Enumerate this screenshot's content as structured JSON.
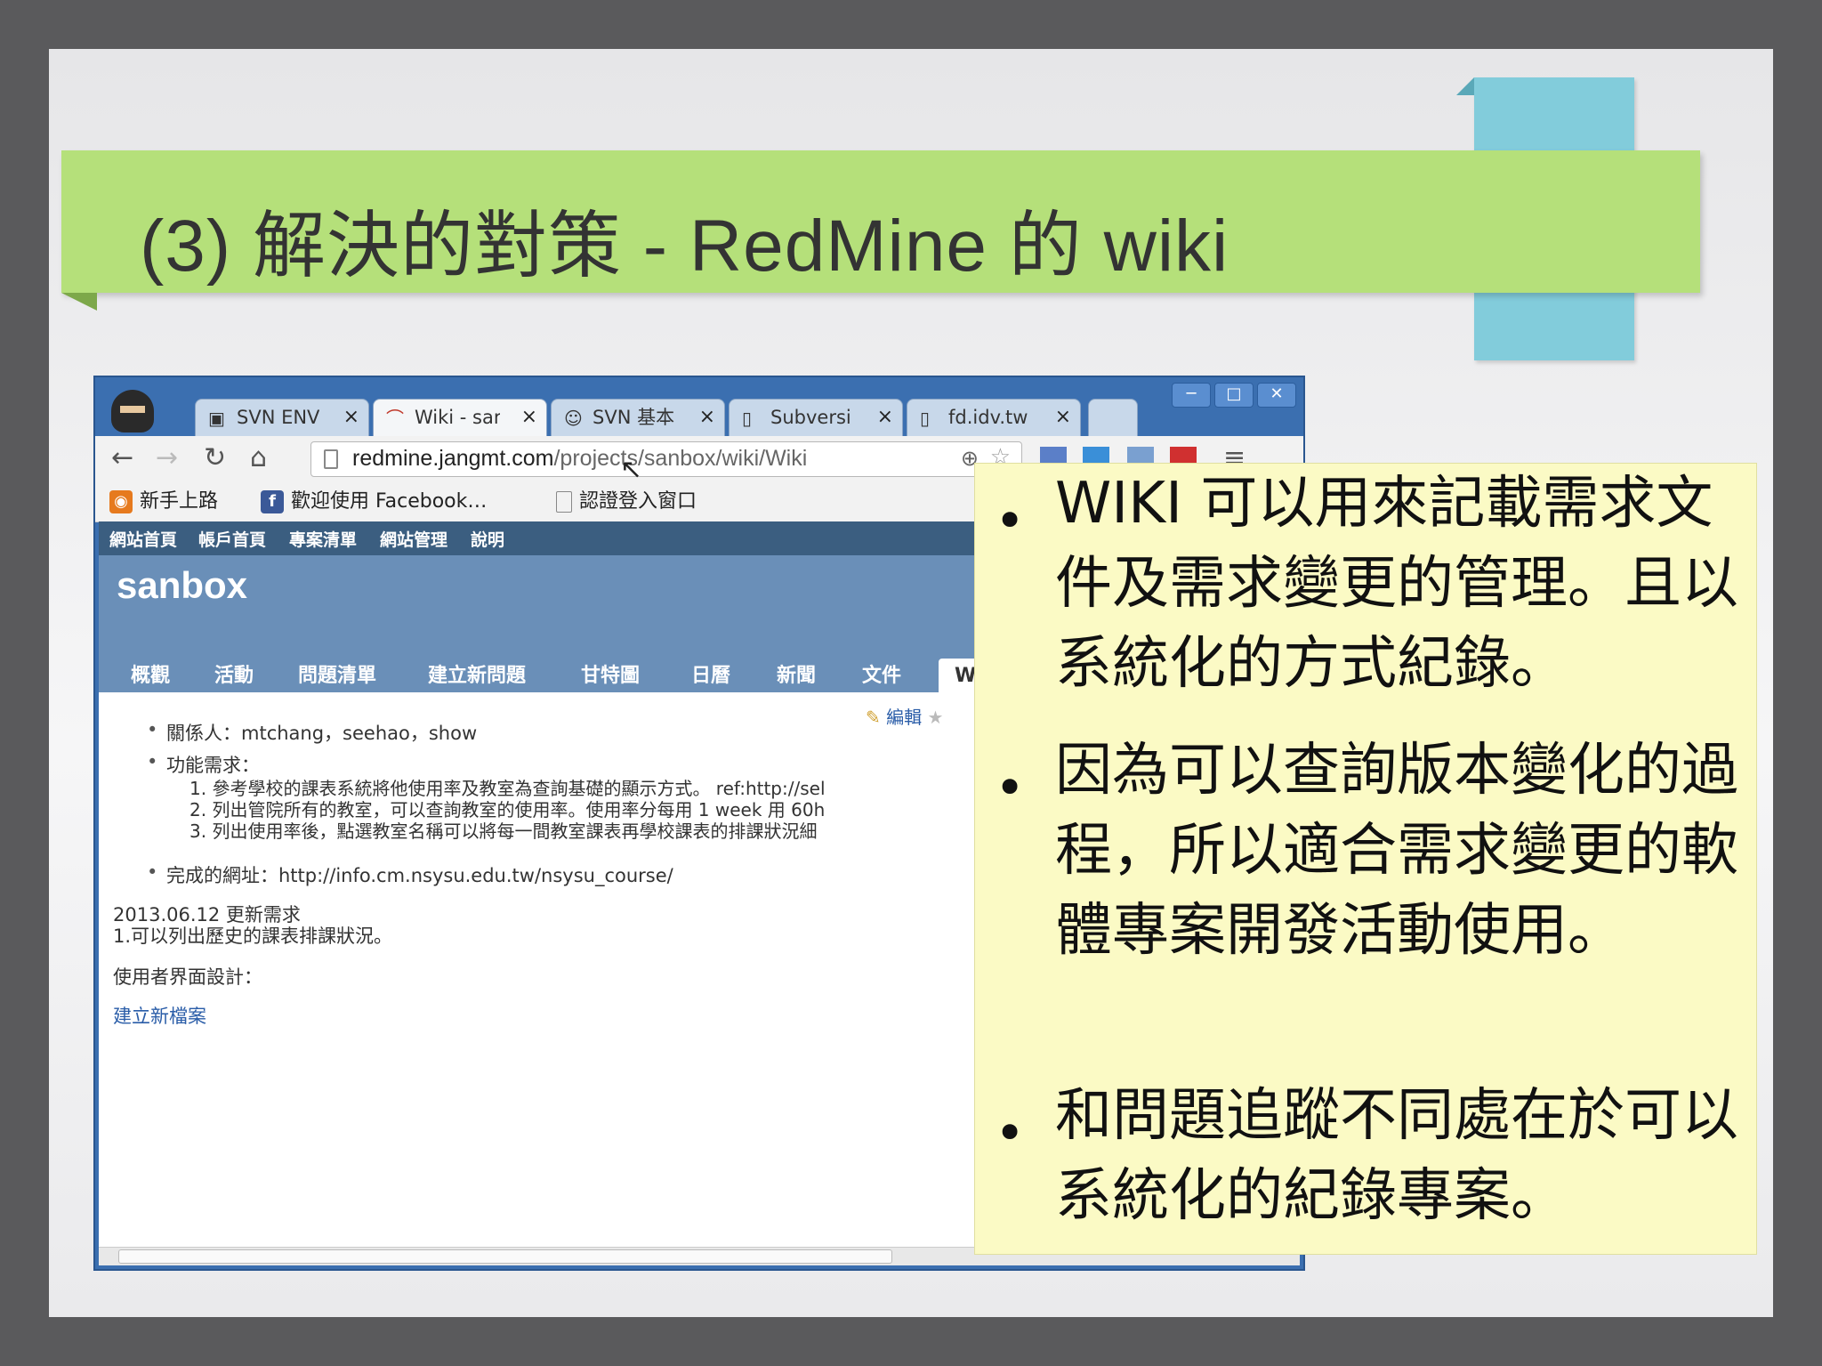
{
  "slide": {
    "title": "(3) 解決的對策 - RedMine  的 wiki"
  },
  "browser": {
    "tabs": [
      {
        "label": "SVN ENV",
        "icon": "camera-icon",
        "close": "×"
      },
      {
        "label": "Wiki - sar",
        "icon": "redmine-icon",
        "close": "×"
      },
      {
        "label": "SVN 基本",
        "icon": "avatar-icon",
        "close": "×"
      },
      {
        "label": "Subversi",
        "icon": "page-icon",
        "close": "×"
      },
      {
        "label": "fd.idv.tw",
        "icon": "page-icon",
        "close": "×"
      }
    ],
    "window_controls": {
      "minimize": "─",
      "maximize": "□",
      "close": "✕"
    },
    "url": {
      "host": "redmine.jangmt.com",
      "path": "/projects/sanbox/wiki/Wiki"
    },
    "bookmarks": [
      {
        "label": "新手上路",
        "icon": "firefox-icon"
      },
      {
        "label": "歡迎使用 Facebook…",
        "icon": "facebook-icon"
      },
      {
        "label": "認證登入窗口",
        "icon": "page-icon"
      }
    ]
  },
  "redmine": {
    "top_menu": [
      "網站首頁",
      "帳戶首頁",
      "專案清單",
      "網站管理",
      "說明"
    ],
    "project_name": "sanbox",
    "project_tabs": [
      "概觀",
      "活動",
      "問題清單",
      "建立新問題",
      "甘特圖",
      "日曆",
      "新聞",
      "文件",
      "W"
    ],
    "edit_label": "編輯",
    "wiki": {
      "related_people": "關係人：mtchang，seehao，show",
      "requirements_title": "功能需求：",
      "requirements": [
        "1. 參考學校的課表系統將他使用率及教室為查詢基礎的顯示方式。  ref:http://sel",
        "2. 列出管院所有的教室，可以查詢教室的使用率。使用率分每用 1 week 用 60h",
        "3. 列出使用率後，點選教室名稱可以將每一間教室課表再學校課表的排課狀況細"
      ],
      "site_url": "完成的網址：http://info.cm.nsysu.edu.tw/nsysu_course/",
      "update_date": "2013.06.12 更新需求",
      "update_item": "1.可以列出歷史的課表排課狀況。",
      "ui_design": "使用者界面設計：",
      "new_file_link": "建立新檔案"
    }
  },
  "callout": {
    "points": [
      "WIKI 可以用來記載需求文件及需求變更的管理。且以系統化的方式紀錄。",
      "因為可以查詢版本變化的過程，所以適合需求變更的軟體專案開發活動使用。",
      "和問題追蹤不同處在於可以系統化的紀錄專案。"
    ]
  },
  "colors": {
    "title_band": "#b5e07a",
    "accent_blue": "#82ccdb",
    "callout_bg": "#fbfac5",
    "redmine_header": "#6a8fb8"
  }
}
